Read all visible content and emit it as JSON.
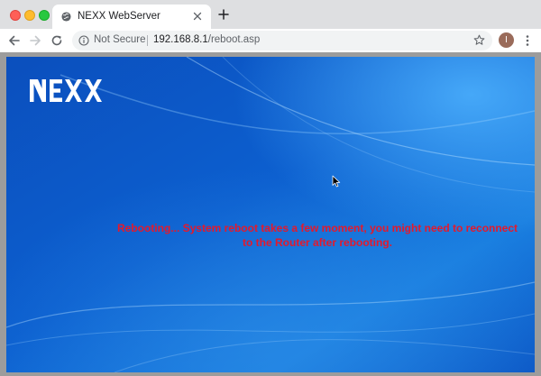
{
  "browser": {
    "tab": {
      "title": "NEXX WebServer",
      "favicon": "globe-icon"
    },
    "toolbar": {
      "security_label": "Not Secure",
      "url_host": "192.168.8.1",
      "url_path": "/reboot.asp",
      "profile_initial": "I"
    }
  },
  "page": {
    "logo_text": "NEXX",
    "message": "Rebooting... System reboot takes a few moment, you might need to reconnect to the Router after rebooting.",
    "colors": {
      "message": "#e4192c",
      "background": "#0a55c4",
      "logo": "#ffffff"
    }
  }
}
